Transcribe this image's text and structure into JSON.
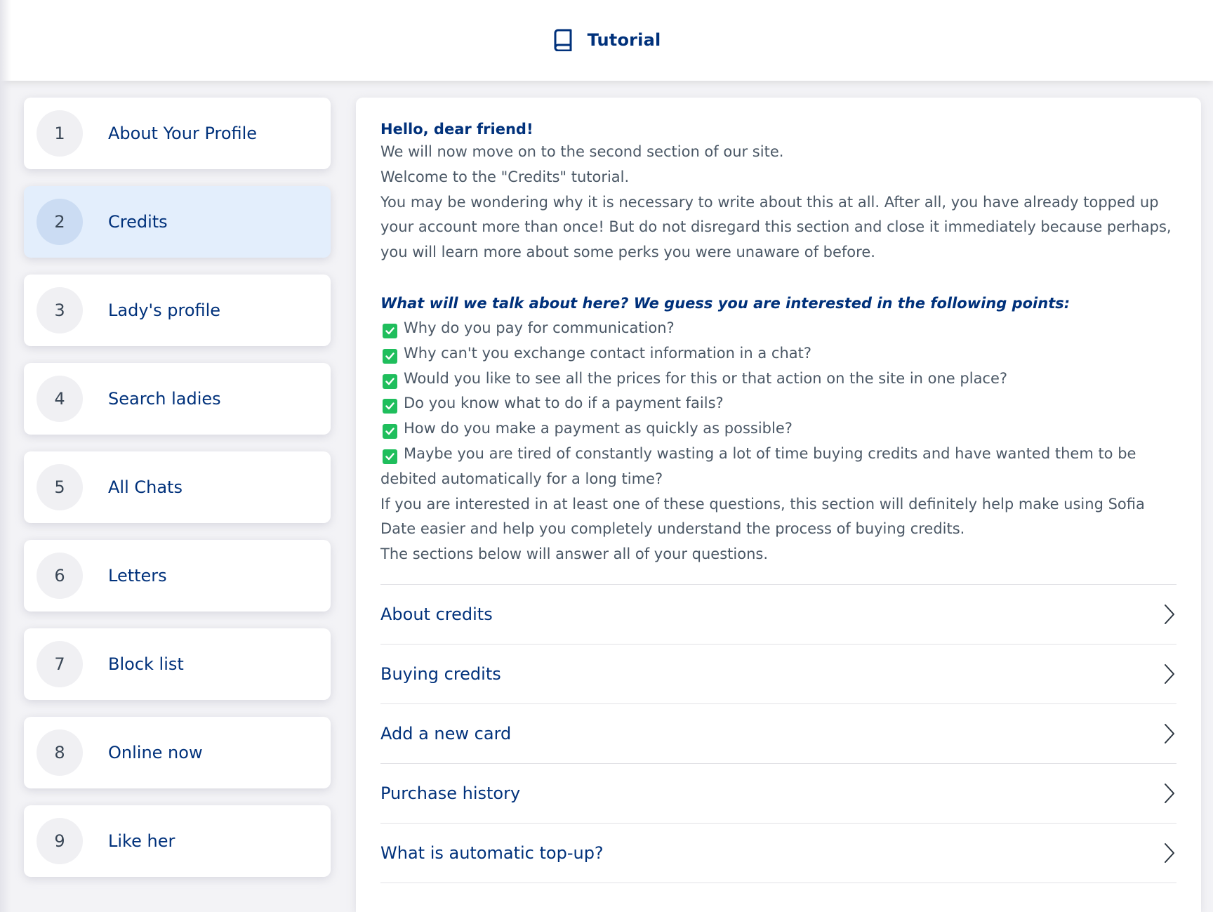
{
  "header": {
    "title": "Tutorial",
    "icon": "book-icon"
  },
  "sidebar": {
    "items": [
      {
        "number": "1",
        "label": "About Your Profile",
        "active": false
      },
      {
        "number": "2",
        "label": "Credits",
        "active": true
      },
      {
        "number": "3",
        "label": "Lady's profile",
        "active": false
      },
      {
        "number": "4",
        "label": "Search ladies",
        "active": false
      },
      {
        "number": "5",
        "label": "All Chats",
        "active": false
      },
      {
        "number": "6",
        "label": "Letters",
        "active": false
      },
      {
        "number": "7",
        "label": "Block list",
        "active": false
      },
      {
        "number": "8",
        "label": "Online now",
        "active": false
      },
      {
        "number": "9",
        "label": "Like her",
        "active": false
      }
    ]
  },
  "content": {
    "greeting": "Hello, dear friend!",
    "intro": [
      "We will now move on to the second section of our site.",
      "Welcome to the \"Credits\" tutorial.",
      "You may be wondering why it is necessary to write about this at all. After all, you have already topped up your account more than once! But do not disregard this section and close it immediately because perhaps, you will learn more about some perks you were unaware of before."
    ],
    "question": "What will we talk about here? We guess you are interested in the following points:",
    "checklist": [
      "Why do you pay for communication?",
      "Why can't you exchange contact information in a chat?",
      "Would you like to see all the prices for this or that action on the site in one place?",
      "Do you know what to do if a payment fails?",
      "How do you make a payment as quickly as possible?",
      "Maybe you are tired of constantly wasting a lot of time buying credits and have wanted them to be debited automatically for a long time?"
    ],
    "outro": [
      "If you are interested in at least one of these questions, this section will definitely help make using Sofia Date easier and help you completely understand the process of buying credits.",
      "The sections below will answer all of your questions."
    ],
    "sections": [
      {
        "label": "About credits"
      },
      {
        "label": "Buying credits"
      },
      {
        "label": "Add a new card"
      },
      {
        "label": "Purchase history"
      },
      {
        "label": "What is automatic top-up?"
      }
    ]
  },
  "colors": {
    "brand_navy": "#00317b",
    "active_step_bg": "#e3eefc",
    "check_green": "#1fbe5c",
    "body_text": "#4b5866",
    "page_bg": "#f3f3f6"
  }
}
